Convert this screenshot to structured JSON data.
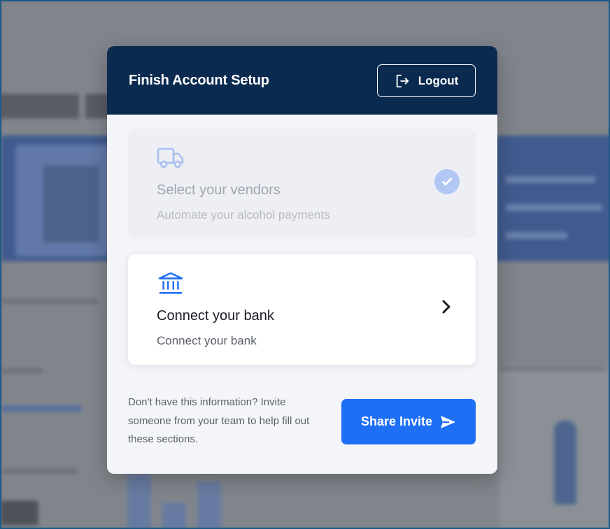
{
  "modal": {
    "title": "Finish Account Setup",
    "logout_label": "Logout",
    "steps": [
      {
        "icon": "truck-icon",
        "title": "Select your vendors",
        "subtitle": "Automate your alcohol payments",
        "status": "completed"
      },
      {
        "icon": "bank-icon",
        "title": "Connect your bank",
        "subtitle": "Connect your bank",
        "status": "pending"
      }
    ],
    "invite_text": "Don't have this information? Invite someone from your team to help fill out these sections.",
    "share_label": "Share Invite"
  },
  "colors": {
    "header_bg": "#0b2a4f",
    "primary": "#1f6ff5",
    "icon_blue": "#1f6ff5",
    "completed_badge": "#b3c7f5"
  }
}
